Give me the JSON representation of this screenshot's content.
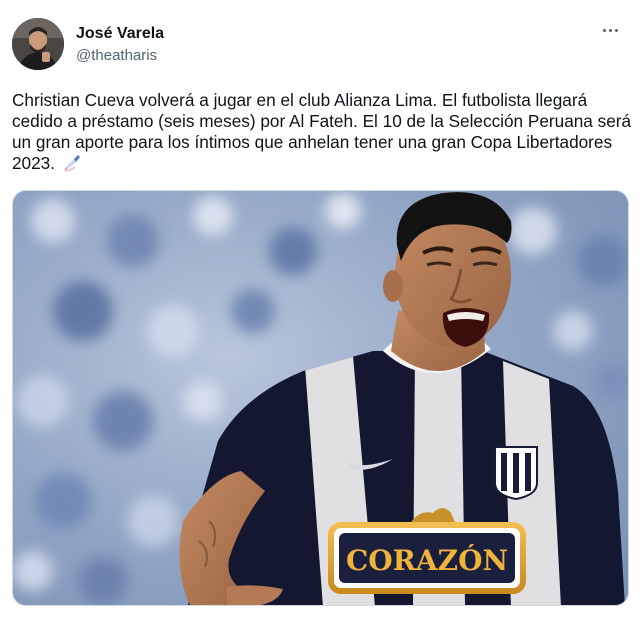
{
  "tweet": {
    "author": {
      "display_name": "José Varela",
      "handle": "@theatharis"
    },
    "text": "Christian Cueva volverá a jugar en el club Alianza Lima. El futbolista llegará cedido a préstamo (seis meses) por Al Fateh. El 10 de la Selección Peruana será un gran aporte para los íntimos que anhelan tener una gran Copa Libertadores 2023.",
    "emoji": "writing-hand-icon",
    "media": {
      "sponsor_text": "CORAZÓN"
    }
  },
  "icons": {
    "more": "more-options-icon"
  },
  "colors": {
    "text": "#0f1419",
    "secondary": "#536471",
    "jersey_dark": "#151a35",
    "jersey_light": "#ffffff",
    "sponsor_gold": "#e5a42e"
  }
}
